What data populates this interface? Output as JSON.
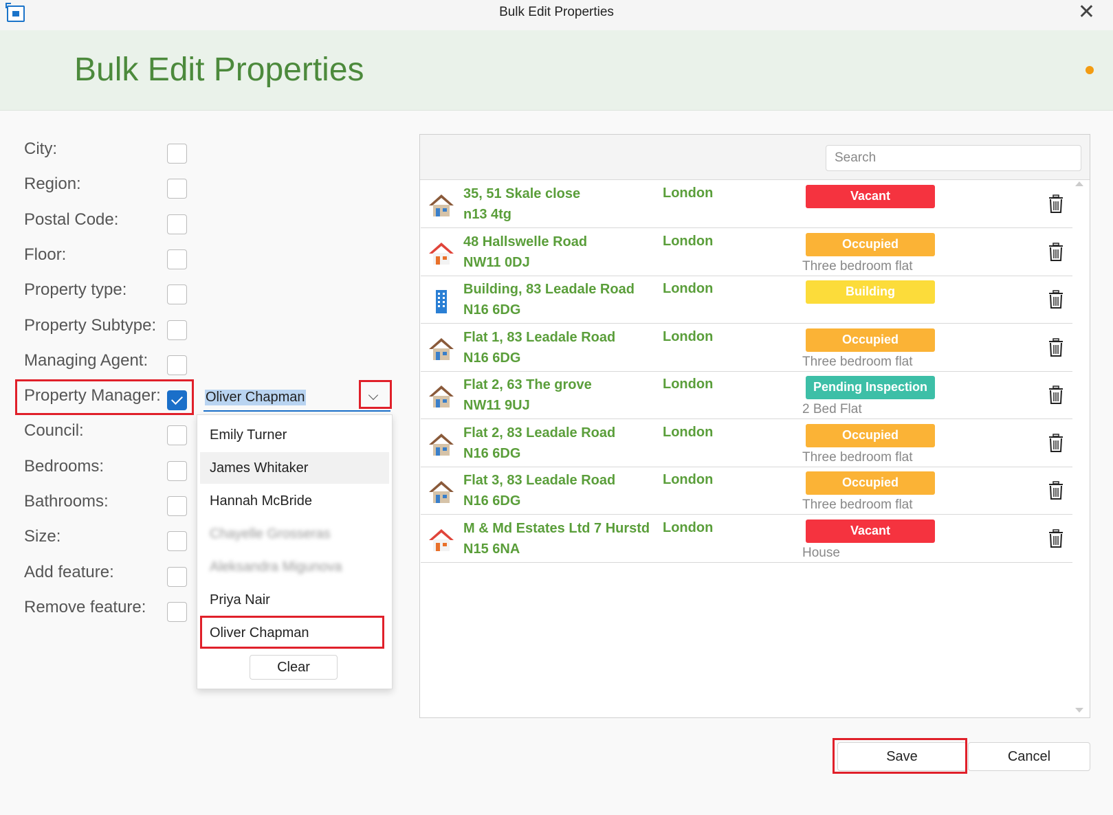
{
  "window": {
    "title": "Bulk Edit Properties",
    "close_glyph": "✕"
  },
  "header": {
    "title": "Bulk Edit Properties",
    "status_dot_color": "#f39c12"
  },
  "fields": [
    {
      "label": "City:",
      "checked": false
    },
    {
      "label": "Region:",
      "checked": false
    },
    {
      "label": "Postal Code:",
      "checked": false
    },
    {
      "label": "Floor:",
      "checked": false
    },
    {
      "label": "Property type:",
      "checked": false
    },
    {
      "label": "Property Subtype:",
      "checked": false
    },
    {
      "label": "Managing Agent:",
      "checked": false
    },
    {
      "label": "Property Manager:",
      "checked": true
    },
    {
      "label": "Council:",
      "checked": false
    },
    {
      "label": "Bedrooms:",
      "checked": false
    },
    {
      "label": "Bathrooms:",
      "checked": false
    },
    {
      "label": "Size:",
      "checked": false
    },
    {
      "label": "Add feature:",
      "checked": false
    },
    {
      "label": "Remove feature:",
      "checked": false
    }
  ],
  "property_manager": {
    "selected": "Oliver Chapman",
    "options": [
      {
        "label": "Emily Turner"
      },
      {
        "label": "James Whitaker",
        "hover": true
      },
      {
        "label": "Hannah McBride"
      },
      {
        "label": "Chayelle Grosseras",
        "blurred": true
      },
      {
        "label": "Aleksandra Migunova",
        "blurred": true
      },
      {
        "label": "Priya Nair"
      },
      {
        "label": "Oliver Chapman",
        "highlighted": true
      }
    ],
    "clear_label": "Clear"
  },
  "search": {
    "placeholder": "Search",
    "value": ""
  },
  "properties": [
    {
      "address": "35, 51 Skale close",
      "postcode": "n13 4tg",
      "city": "London",
      "status": "Vacant",
      "status_color": "#f5333f",
      "subtype": "",
      "icon": "house-icon"
    },
    {
      "address": "48 Hallswelle Road",
      "postcode": "NW11 0DJ",
      "city": "London",
      "status": "Occupied",
      "status_color": "#fbb336",
      "subtype": "Three bedroom flat",
      "icon": "house-red-icon"
    },
    {
      "address": "Building, 83 Leadale Road",
      "postcode": "N16 6DG",
      "city": "London",
      "status": "Building",
      "status_color": "#fcdc3a",
      "subtype": "",
      "icon": "building-icon"
    },
    {
      "address": "Flat 1, 83 Leadale Road",
      "postcode": "N16 6DG",
      "city": "London",
      "status": "Occupied",
      "status_color": "#fbb336",
      "subtype": "Three bedroom flat",
      "icon": "house-icon"
    },
    {
      "address": "Flat 2, 63 The grove",
      "postcode": "NW11 9UJ",
      "city": "London",
      "status": "Pending Inspection",
      "status_color": "#3dbfa7",
      "subtype": "2 Bed Flat",
      "icon": "house-icon"
    },
    {
      "address": "Flat 2, 83 Leadale Road",
      "postcode": "N16 6DG",
      "city": "London",
      "status": "Occupied",
      "status_color": "#fbb336",
      "subtype": "Three bedroom flat",
      "icon": "house-icon"
    },
    {
      "address": "Flat 3, 83 Leadale Road",
      "postcode": "N16 6DG",
      "city": "London",
      "status": "Occupied",
      "status_color": "#fbb336",
      "subtype": "Three bedroom flat",
      "icon": "house-icon"
    },
    {
      "address": "M & Md Estates Ltd 7 Hurstd",
      "postcode": "N15 6NA",
      "city": "London",
      "status": "Vacant",
      "status_color": "#f5333f",
      "subtype": "House",
      "icon": "house-red-icon"
    }
  ],
  "footer": {
    "save_label": "Save",
    "cancel_label": "Cancel"
  },
  "colors": {
    "accent": "#1a6fc9",
    "title_green": "#4c8a3c",
    "address_green": "#5a9e3a",
    "highlight_red": "#e0202a"
  }
}
